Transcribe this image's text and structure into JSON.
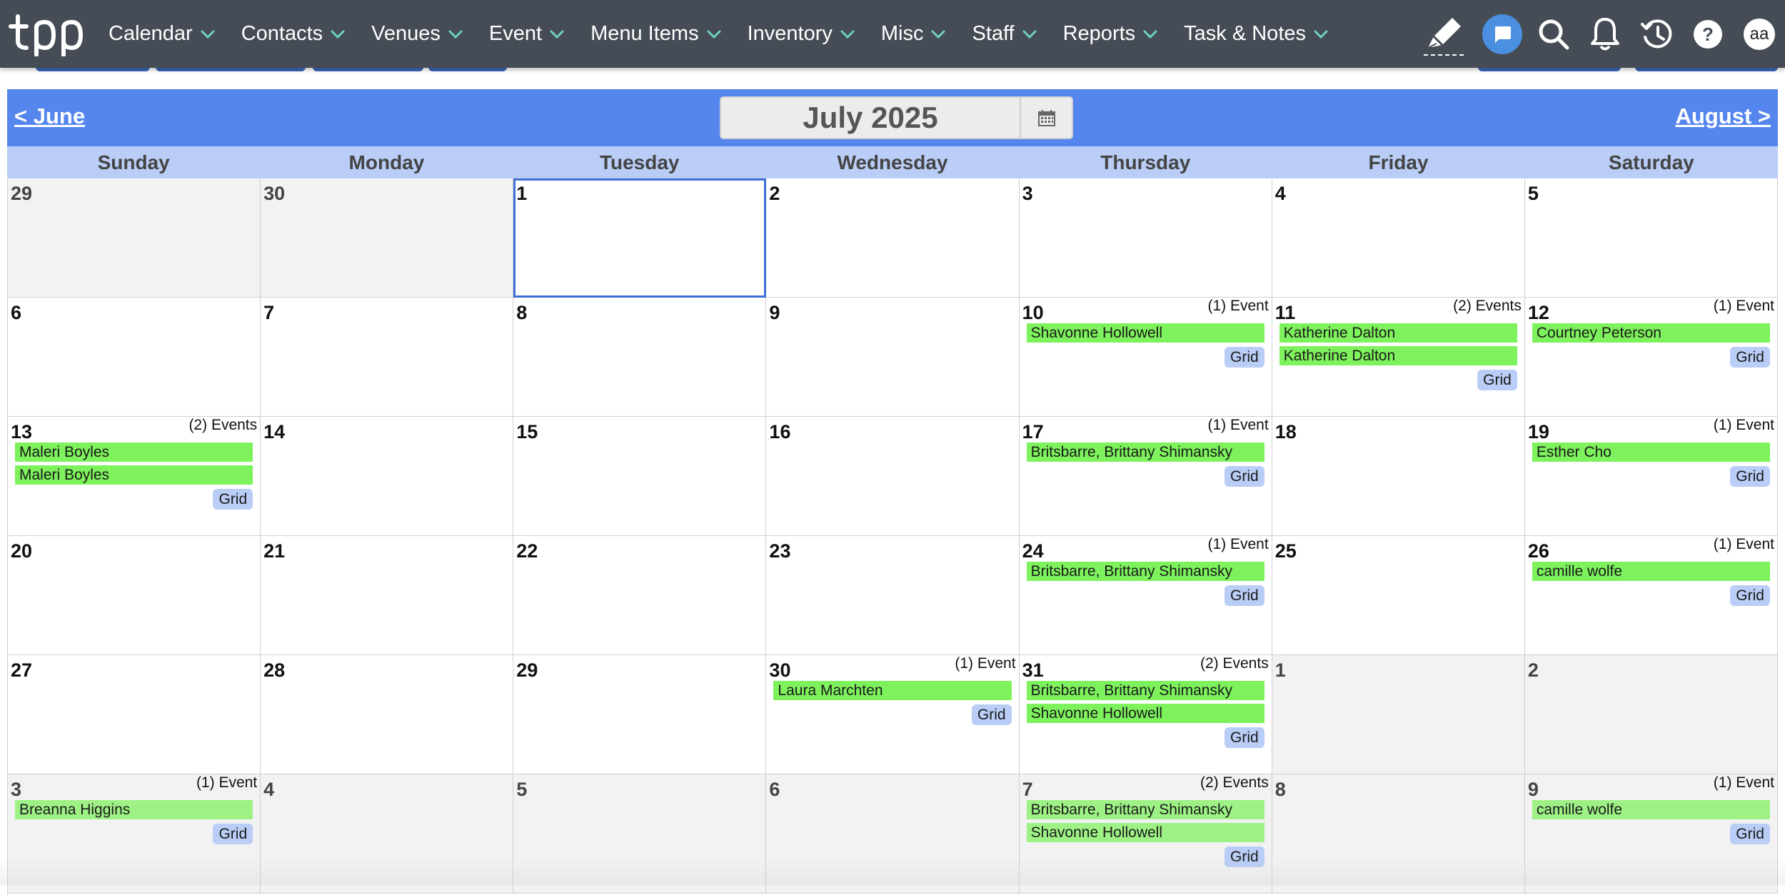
{
  "nav": {
    "menu": [
      "Calendar",
      "Contacts",
      "Venues",
      "Event",
      "Menu Items",
      "Inventory",
      "Misc",
      "Staff",
      "Reports",
      "Task & Notes"
    ],
    "user_initials": "aa"
  },
  "calendar": {
    "prev_label": "< June",
    "next_label": "August >",
    "month_title": "July 2025",
    "weekdays": [
      "Sunday",
      "Monday",
      "Tuesday",
      "Wednesday",
      "Thursday",
      "Friday",
      "Saturday"
    ],
    "grid_label": "Grid",
    "weeks": [
      [
        {
          "day": "29",
          "muted": true
        },
        {
          "day": "30",
          "muted": true
        },
        {
          "day": "1",
          "today": true
        },
        {
          "day": "2"
        },
        {
          "day": "3"
        },
        {
          "day": "4"
        },
        {
          "day": "5"
        }
      ],
      [
        {
          "day": "6"
        },
        {
          "day": "7"
        },
        {
          "day": "8"
        },
        {
          "day": "9"
        },
        {
          "day": "10",
          "count": "(1) Event",
          "events": [
            "Shavonne Hollowell"
          ]
        },
        {
          "day": "11",
          "count": "(2) Events",
          "events": [
            "Katherine Dalton",
            "Katherine Dalton"
          ]
        },
        {
          "day": "12",
          "count": "(1) Event",
          "events": [
            "Courtney Peterson"
          ]
        }
      ],
      [
        {
          "day": "13",
          "count": "(2) Events",
          "events": [
            "Maleri Boyles",
            "Maleri Boyles"
          ]
        },
        {
          "day": "14"
        },
        {
          "day": "15"
        },
        {
          "day": "16"
        },
        {
          "day": "17",
          "count": "(1) Event",
          "events": [
            "Britsbarre, Brittany Shimansky"
          ]
        },
        {
          "day": "18"
        },
        {
          "day": "19",
          "count": "(1) Event",
          "events": [
            "Esther Cho"
          ]
        }
      ],
      [
        {
          "day": "20"
        },
        {
          "day": "21"
        },
        {
          "day": "22"
        },
        {
          "day": "23"
        },
        {
          "day": "24",
          "count": "(1) Event",
          "events": [
            "Britsbarre, Brittany Shimansky"
          ]
        },
        {
          "day": "25"
        },
        {
          "day": "26",
          "count": "(1) Event",
          "events": [
            "camille wolfe"
          ]
        }
      ],
      [
        {
          "day": "27"
        },
        {
          "day": "28"
        },
        {
          "day": "29"
        },
        {
          "day": "30",
          "count": "(1) Event",
          "events": [
            "Laura Marchten"
          ]
        },
        {
          "day": "31",
          "count": "(2) Events",
          "events": [
            "Britsbarre, Brittany Shimansky",
            "Shavonne Hollowell"
          ]
        },
        {
          "day": "1",
          "muted": true
        },
        {
          "day": "2",
          "muted": true
        }
      ],
      [
        {
          "day": "3",
          "muted": true,
          "count": "(1) Event",
          "events": [
            "Breanna Higgins"
          ]
        },
        {
          "day": "4",
          "muted": true
        },
        {
          "day": "5",
          "muted": true
        },
        {
          "day": "6",
          "muted": true
        },
        {
          "day": "7",
          "muted": true,
          "count": "(2) Events",
          "events": [
            "Britsbarre, Brittany Shimansky",
            "Shavonne Hollowell"
          ]
        },
        {
          "day": "8",
          "muted": true
        },
        {
          "day": "9",
          "muted": true,
          "count": "(1) Event",
          "events": [
            "camille wolfe"
          ]
        }
      ]
    ]
  },
  "colors": {
    "nav_bg": "#454c55",
    "header_blue": "#5586ee",
    "weekday_blue": "#b9cdf6",
    "event_green": "#7df25c",
    "chevron_teal": "#6fd0c6"
  },
  "icons": [
    "tpp-logo",
    "chevron-down-icon",
    "pen-icon",
    "chat-icon",
    "search-icon",
    "bell-icon",
    "history-icon",
    "help-icon",
    "calendar-icon"
  ]
}
